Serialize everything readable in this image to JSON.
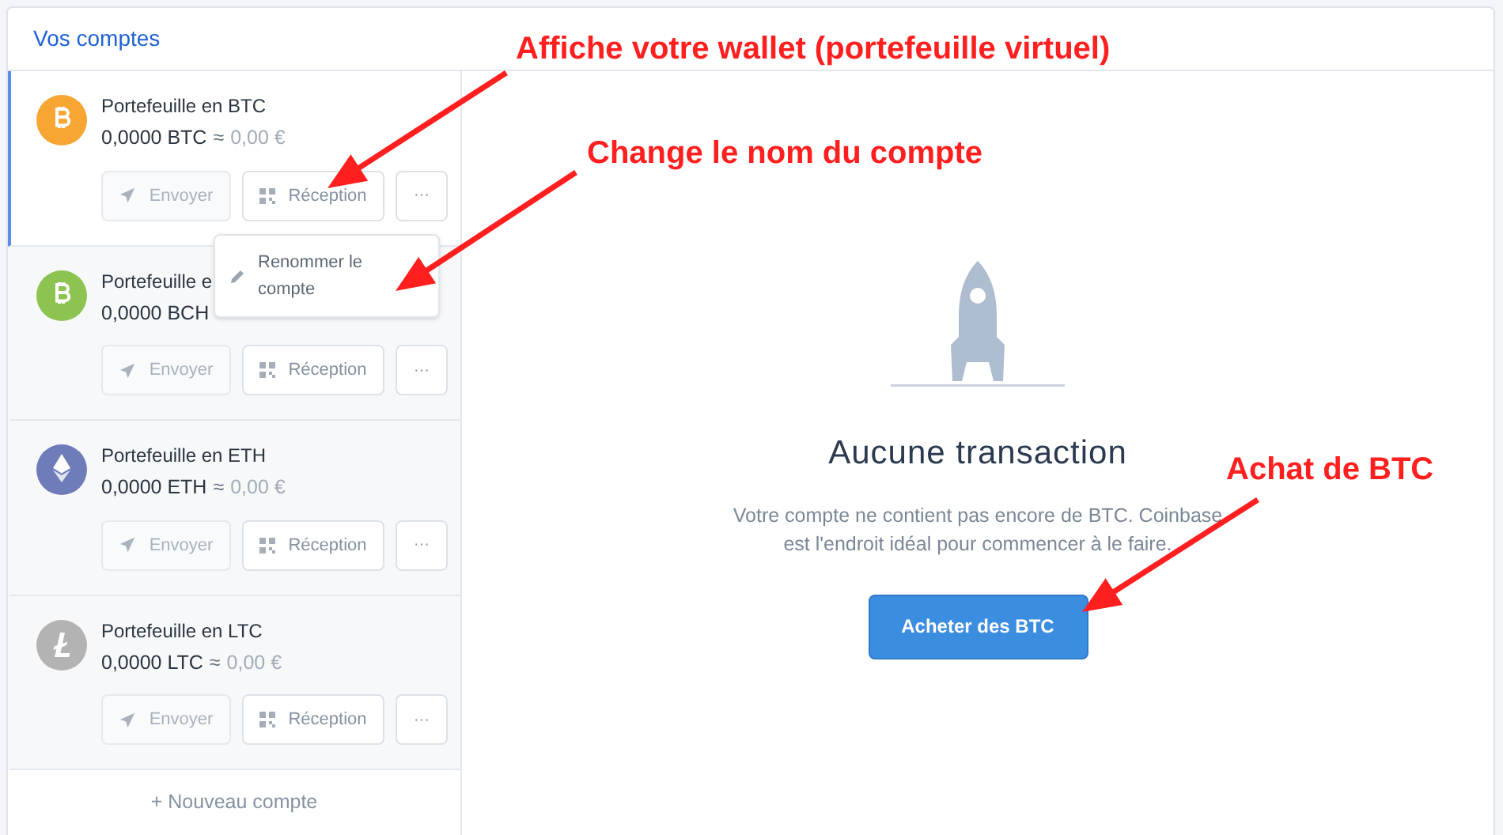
{
  "sidebar": {
    "title": "Vos comptes",
    "accounts": [
      {
        "name": "Portefeuille en BTC",
        "balance": "0,0000 BTC",
        "approx": "≈",
        "fiat": "0,00 €",
        "color": "#f7a633",
        "kind": "bitcoin",
        "selected": true,
        "send": {
          "label": "Envoyer",
          "disabled": true
        },
        "receive": {
          "label": "Réception"
        },
        "more": "···"
      },
      {
        "name": "Portefeuille e",
        "balance": "0,0000 BCH",
        "color": "#8dc351",
        "kind": "bitcoin",
        "selected": false,
        "send": {
          "label": "Envoyer",
          "disabled": true
        },
        "receive": {
          "label": "Réception"
        },
        "more": "···"
      },
      {
        "name": "Portefeuille en ETH",
        "balance": "0,0000 ETH",
        "approx": "≈",
        "fiat": "0,00 €",
        "color": "#6f7cba",
        "kind": "ethereum",
        "selected": false,
        "send": {
          "label": "Envoyer",
          "disabled": true
        },
        "receive": {
          "label": "Réception"
        },
        "more": "···"
      },
      {
        "name": "Portefeuille en LTC",
        "balance": "0,0000 LTC",
        "approx": "≈",
        "fiat": "0,00 €",
        "color": "#b3b3b3",
        "kind": "litecoin",
        "selected": false,
        "send": {
          "label": "Envoyer",
          "disabled": true
        },
        "receive": {
          "label": "Réception"
        },
        "more": "···"
      }
    ],
    "menu": {
      "items": [
        {
          "label": "Renommer le compte"
        }
      ]
    },
    "new_account": "+ Nouveau compte"
  },
  "main": {
    "title": "Aucune transaction",
    "message": "Votre compte ne contient pas encore de BTC. Coinbase est l'endroit idéal pour commencer à le faire.",
    "button": "Acheter des BTC"
  },
  "annotations": [
    "Affiche votre wallet (portefeuille virtuel)",
    "Change le nom du compte",
    "Achat de BTC"
  ]
}
